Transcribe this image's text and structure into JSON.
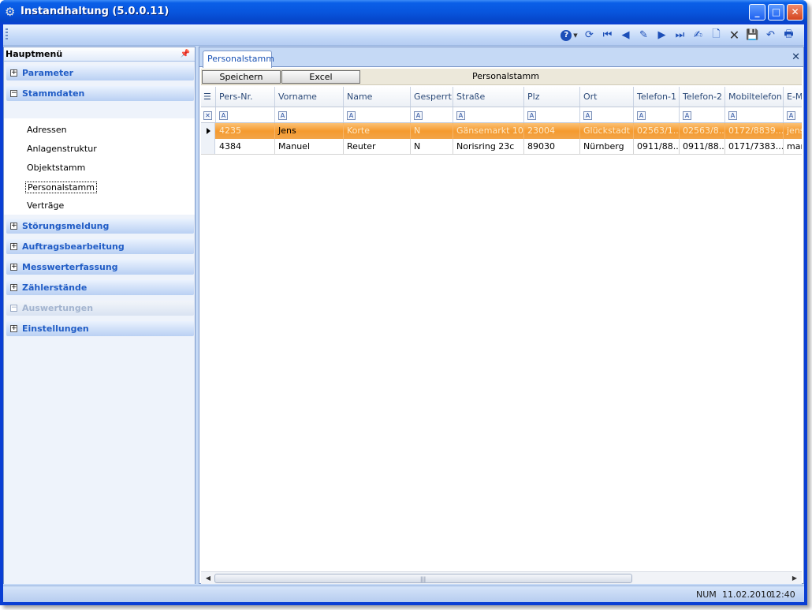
{
  "window": {
    "title": "Instandhaltung (5.0.0.11)",
    "icon": "gear-icon",
    "controls": [
      "minimize",
      "maximize",
      "close"
    ]
  },
  "toolbar": {
    "icons": [
      "help-icon",
      "refresh-icon",
      "first-record-icon",
      "previous-record-icon",
      "edit-record-icon",
      "next-record-icon",
      "last-record-icon",
      "edit-icon",
      "new-document-icon",
      "delete-icon",
      "save-icon",
      "undo-icon",
      "print-icon"
    ]
  },
  "sidebar": {
    "title": "Hauptmenü",
    "groups": [
      {
        "label": "Parameter",
        "state": "+"
      },
      {
        "label": "Stammdaten",
        "state": "−"
      },
      {
        "label": "Störungsmeldung",
        "state": "+"
      },
      {
        "label": "Auftragsbearbeitung",
        "state": "+"
      },
      {
        "label": "Messwerterfassung",
        "state": "+"
      },
      {
        "label": "Zählerstände",
        "state": "+"
      },
      {
        "label": "Auswertungen",
        "state": "−"
      },
      {
        "label": "Einstellungen",
        "state": "+"
      }
    ],
    "subitems": [
      "Adressen",
      "Anlagenstruktur",
      "Objektstamm",
      "Personalstamm",
      "Verträge"
    ],
    "selected_subitem": "Personalstamm"
  },
  "main": {
    "tab": "Personalstamm",
    "actions": {
      "save": "Speichern",
      "excel": "Excel"
    },
    "panel_title": "Personalstamm",
    "grid": {
      "columns": [
        "Pers-Nr.",
        "Vorname",
        "Name",
        "Gesperrt",
        "Straße",
        "Plz",
        "Ort",
        "Telefon-1",
        "Telefon-2",
        "Mobiltelefon",
        "E-Ma"
      ],
      "filter_glyph": "A",
      "rows": [
        [
          "4235",
          "Jens",
          "Korte",
          "N",
          "Gänsemarkt 10",
          "23004",
          "Glückstadt",
          "02563/1...",
          "02563/8...",
          "0172/8839...",
          "jens"
        ],
        [
          "4384",
          "Manuel",
          "Reuter",
          "N",
          "Norisring 23c",
          "89030",
          "Nürnberg",
          "0911/88...",
          "0911/88...",
          "0171/7383...",
          "man"
        ]
      ]
    }
  },
  "statusbar": {
    "num": "NUM",
    "date": "11.02.2010",
    "time": "12:40"
  }
}
